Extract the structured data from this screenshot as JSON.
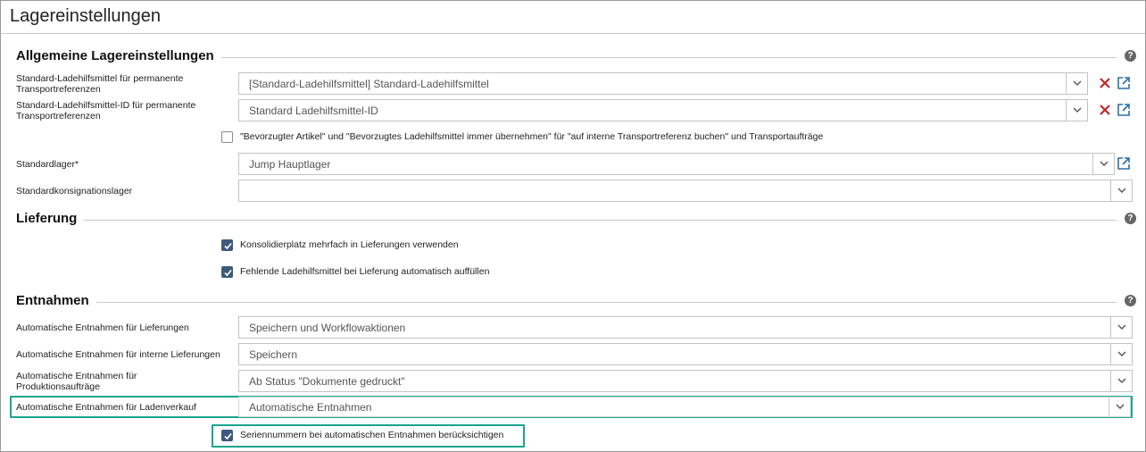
{
  "window": {
    "title": "Lagereinstellungen"
  },
  "sections": {
    "general": {
      "title": "Allgemeine Lagereinstellungen",
      "help": "?",
      "fields": {
        "default_lhm": {
          "label": "Standard-Ladehilfsmittel für permanente Transportreferenzen",
          "value": "[Standard-Ladehilfsmittel] Standard-Ladehilfsmittel"
        },
        "default_lhm_id": {
          "label": "Standard-Ladehilfsmittel-ID für permanente Transportreferenzen",
          "value": "Standard Ladehilfsmittel-ID"
        },
        "prefer_checkbox": {
          "label": "\"Bevorzugter Artikel\" und \"Bevorzugtes Ladehilfsmittel immer übernehmen\" für \"auf interne Transportreferenz buchen\" und Transportaufträge",
          "checked": false
        },
        "default_warehouse": {
          "label": "Standardlager*",
          "value": "Jump Hauptlager"
        },
        "default_consignment": {
          "label": "Standardkonsignationslager",
          "value": ""
        }
      }
    },
    "delivery": {
      "title": "Lieferung",
      "help": "?",
      "checkboxes": {
        "consolidation": {
          "label": "Konsolidierplatz mehrfach in Lieferungen verwenden",
          "checked": true
        },
        "fill_lhm": {
          "label": "Fehlende Ladehilfsmittel bei Lieferung automatisch auffüllen",
          "checked": true
        }
      }
    },
    "withdrawals": {
      "title": "Entnahmen",
      "help": "?",
      "fields": {
        "deliveries": {
          "label": "Automatische Entnahmen für Lieferungen",
          "value": "Speichern und Workflowaktionen"
        },
        "internal": {
          "label": "Automatische Entnahmen für interne Lieferungen",
          "value": "Speichern"
        },
        "production": {
          "label": "Automatische Entnahmen für Produktionsaufträge",
          "value": "Ab Status \"Dokumente gedruckt\""
        },
        "store_sale": {
          "label": "Automatische Entnahmen für Ladenverkauf",
          "value": "Automatische Entnahmen"
        }
      },
      "checkboxes": {
        "serials": {
          "label": "Seriennummern bei automatischen Entnahmen berücksichtigen",
          "checked": true
        }
      }
    }
  },
  "colors": {
    "highlight": "#1aa58f",
    "checkbox_checked": "#3d5a7c",
    "clear_icon": "#c0282a",
    "open_icon": "#2f6fa8"
  }
}
